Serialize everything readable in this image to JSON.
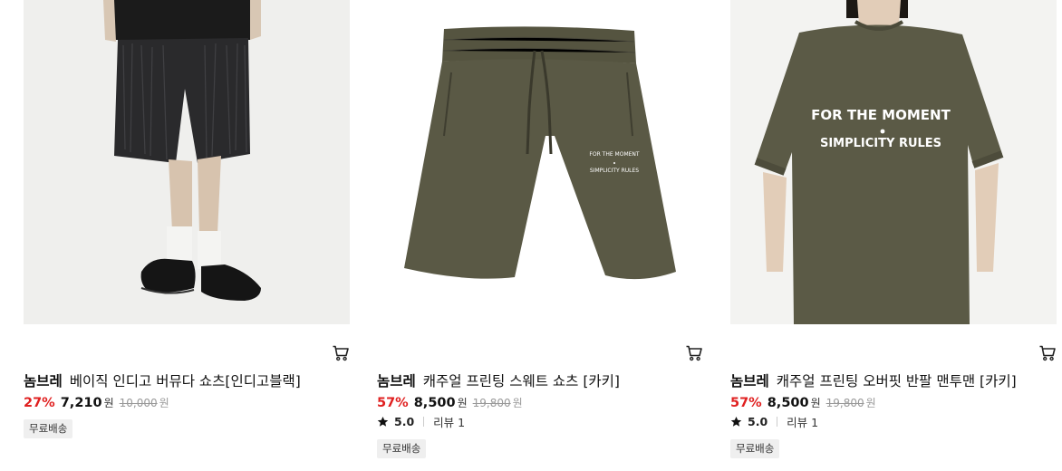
{
  "products": [
    {
      "brand": "놈브레",
      "name": "베이직 인디고 버뮤다 쇼츠[인디고블랙]",
      "discount": "27%",
      "price": "7,210",
      "price_unit": "원",
      "original_price": "10,000",
      "original_unit": "원",
      "badge": "무료배송",
      "image": "black-shorts-model-photo"
    },
    {
      "brand": "놈브레",
      "name": "캐주얼 프린팅 스웨트 쇼츠 [카키]",
      "discount": "57%",
      "price": "8,500",
      "price_unit": "원",
      "original_price": "19,800",
      "original_unit": "원",
      "rating": "5.0",
      "reviews": "리뷰 1",
      "badge": "무료배송",
      "image": "khaki-sweat-shorts-photo",
      "print_line1": "FOR THE MOMENT",
      "print_line2": "SIMPLICITY RULES"
    },
    {
      "brand": "놈브레",
      "name": "캐주얼 프린팅 오버핏 반팔 맨투맨 [카키]",
      "discount": "57%",
      "price": "8,500",
      "price_unit": "원",
      "original_price": "19,800",
      "original_unit": "원",
      "rating": "5.0",
      "reviews": "리뷰 1",
      "badge": "무료배송",
      "image": "khaki-tshirt-model-photo",
      "print_line1": "FOR THE MOMENT",
      "print_line2": "SIMPLICITY RULES"
    }
  ],
  "icons": {
    "cart": "cart-icon",
    "star": "star-icon"
  },
  "colors": {
    "discount": "#e02020",
    "khaki": "#5b5a46",
    "badge_bg": "#efefef"
  }
}
